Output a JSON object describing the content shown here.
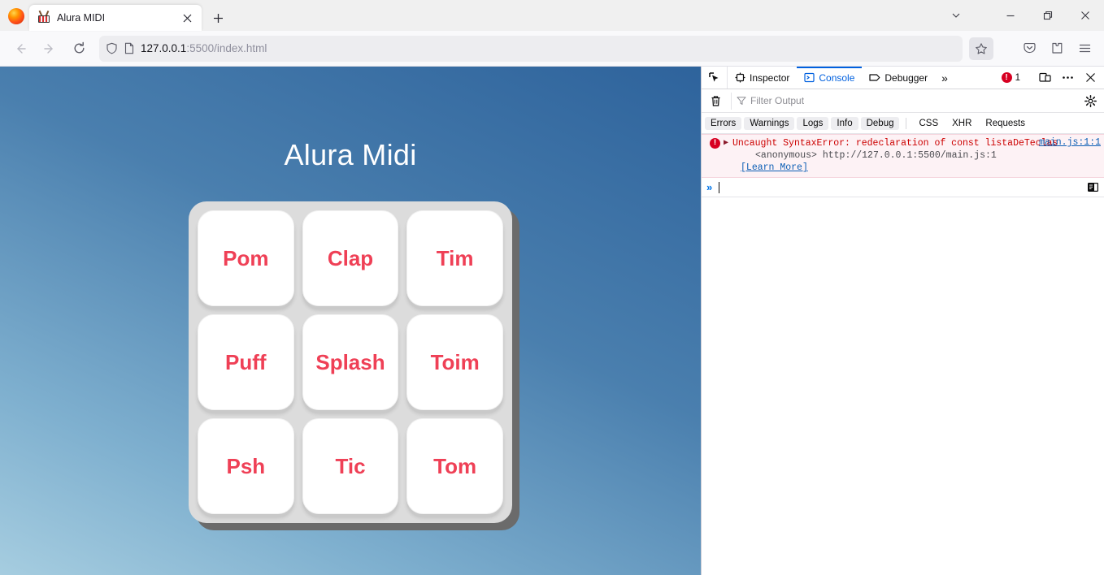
{
  "browser": {
    "tab": {
      "title": "Alura MIDI",
      "favicon": "drum-icon",
      "close_label": "×"
    },
    "new_tab_label": "+",
    "window_controls": {
      "tab_list": "tab-list-chevron-icon",
      "minimize": "minimize-icon",
      "maximize": "maximize-icon",
      "close": "close-icon"
    },
    "nav": {
      "back": "back-arrow-icon",
      "forward": "forward-arrow-icon",
      "reload": "reload-icon"
    },
    "urlbar": {
      "shield_icon": "shield-icon",
      "page_icon": "page-document-icon",
      "url_host": "127.0.0.1",
      "url_rest": ":5500/index.html",
      "bookmark_icon": "star-icon"
    },
    "toolbar_icons": {
      "pocket": "pocket-save-icon",
      "extensions": "extensions-puzzle-icon",
      "menu": "hamburger-menu-icon"
    }
  },
  "page": {
    "title": "Alura Midi",
    "accent_color": "#ef4056",
    "panel_color": "#dcdcdc",
    "keys": [
      {
        "label": "Pom"
      },
      {
        "label": "Clap"
      },
      {
        "label": "Tim"
      },
      {
        "label": "Puff"
      },
      {
        "label": "Splash"
      },
      {
        "label": "Toim"
      },
      {
        "label": "Psh"
      },
      {
        "label": "Tic"
      },
      {
        "label": "Tom"
      }
    ]
  },
  "devtools": {
    "picker_icon": "element-picker-icon",
    "tabs": [
      {
        "label": "Inspector",
        "icon": "inspector-icon",
        "active": false
      },
      {
        "label": "Console",
        "icon": "console-icon",
        "active": true
      },
      {
        "label": "Debugger",
        "icon": "debugger-icon",
        "active": false
      }
    ],
    "more_tabs_label": "»",
    "error_count": "1",
    "right_icons": {
      "responsive": "responsive-design-mode-icon",
      "meatball": "more-options-icon",
      "close": "close-devtools-icon"
    },
    "filterbar": {
      "trash_icon": "trash-clear-icon",
      "filter_icon": "filter-funnel-icon",
      "placeholder": "Filter Output",
      "settings_icon": "gear-icon"
    },
    "chips": [
      {
        "label": "Errors",
        "filled": true
      },
      {
        "label": "Warnings",
        "filled": true
      },
      {
        "label": "Logs",
        "filled": true
      },
      {
        "label": "Info",
        "filled": true
      },
      {
        "label": "Debug",
        "filled": true
      },
      {
        "label": "CSS",
        "filled": false
      },
      {
        "label": "XHR",
        "filled": false
      },
      {
        "label": "Requests",
        "filled": false
      }
    ],
    "message": {
      "icon": "error-badge-icon",
      "expander": "▶",
      "text": "Uncaught SyntaxError: redeclaration of const listaDeTeclas",
      "stack_frame": "<anonymous> http://127.0.0.1:5500/main.js:1",
      "learn_more": "[Learn More]",
      "source": "main.js:1:1"
    },
    "input": {
      "prompt": "»",
      "value": "",
      "editor_toggle_icon": "split-console-editor-icon"
    }
  }
}
